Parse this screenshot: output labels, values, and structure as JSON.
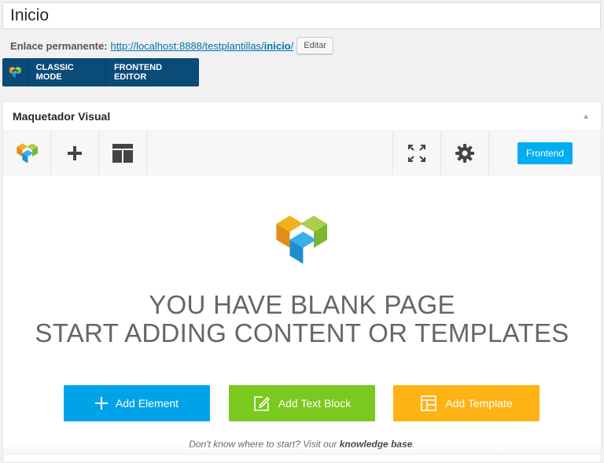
{
  "post": {
    "title": "Inicio"
  },
  "permalink": {
    "label": "Enlace permanente:",
    "url_base": "http://localhost:8888/testplantillas/",
    "url_slug": "inicio",
    "url_end": "/",
    "edit_label": "Editar"
  },
  "mode_bar": {
    "classic_label": "CLASSIC MODE",
    "frontend_editor_label": "FRONTEND EDITOR"
  },
  "builder": {
    "title": "Maquetador Visual",
    "frontend_label": "Frontend",
    "heading_line1": "YOU HAVE BLANK PAGE",
    "heading_line2": "START ADDING CONTENT OR TEMPLATES",
    "add_element_label": "Add Element",
    "add_text_block_label": "Add Text Block",
    "add_template_label": "Add Template",
    "help_prefix": "Don't know where to start? Visit our ",
    "help_link": "knowledge base",
    "help_suffix": "."
  },
  "colors": {
    "mode_bar_bg": "#0a4b78",
    "frontend_btn": "#00aef0",
    "add_element": "#00a3e8",
    "add_text_block": "#7bc91f",
    "add_template": "#fdb314"
  },
  "icons": {
    "logo": "composer-logo-icon",
    "add": "plus-icon",
    "templates": "layout-icon",
    "fullscreen": "fullscreen-icon",
    "settings": "gear-icon",
    "collapse": "triangle-up-icon",
    "text_block": "edit-box-icon"
  }
}
